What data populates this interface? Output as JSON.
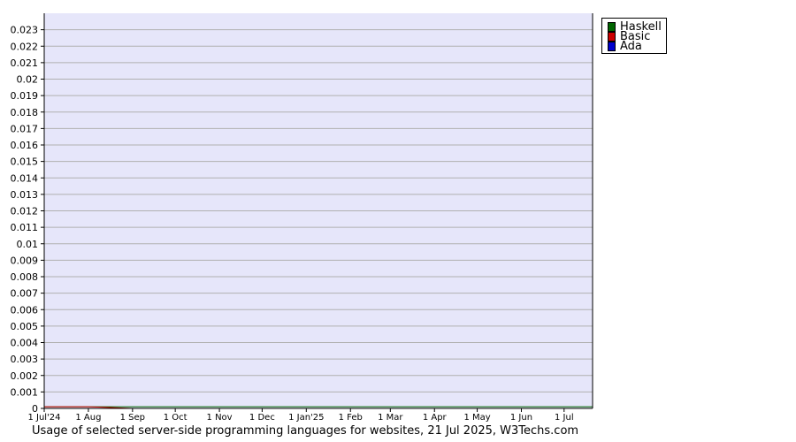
{
  "chart_data": {
    "type": "line",
    "title": "",
    "xlabel": "",
    "ylabel": "",
    "x_ticks": [
      "1 Jul'24",
      "1 Aug",
      "1 Sep",
      "1 Oct",
      "1 Nov",
      "1 Dec",
      "1 Jan'25",
      "1 Feb",
      "1 Mar",
      "1 Apr",
      "1 May",
      "1 Jun",
      "1 Jul"
    ],
    "y_ticks": [
      "0",
      "0.001",
      "0.002",
      "0.003",
      "0.004",
      "0.005",
      "0.006",
      "0.007",
      "0.008",
      "0.009",
      "0.01",
      "0.011",
      "0.012",
      "0.013",
      "0.014",
      "0.015",
      "0.016",
      "0.017",
      "0.018",
      "0.019",
      "0.02",
      "0.021",
      "0.022",
      "0.023"
    ],
    "ylim": [
      0,
      0.024
    ],
    "xlim": [
      "2024-07-01",
      "2025-07-21"
    ],
    "grid": true,
    "legend_position": "top-right, outside plot",
    "plot_background": "#e6e6fa",
    "gridline_color": "#b0b0b0",
    "series": [
      {
        "name": "Haskell",
        "color": "#006600",
        "points": [
          [
            "2024-07-01",
            0.0001
          ],
          [
            "2025-07-21",
            0.0001
          ]
        ]
      },
      {
        "name": "Basic",
        "color": "#cc0000",
        "points": [
          [
            "2024-07-01",
            0.0001
          ],
          [
            "2024-08-01",
            0.0001
          ],
          [
            "2024-09-01",
            0.0
          ],
          [
            "2025-07-21",
            0.0
          ]
        ]
      },
      {
        "name": "Ada",
        "color": "#0000cc",
        "points": [
          [
            "2024-07-01",
            0.0
          ],
          [
            "2025-07-21",
            0.0
          ]
        ]
      }
    ]
  },
  "caption": "Usage of selected server-side programming languages for websites, 21 Jul 2025, W3Techs.com"
}
